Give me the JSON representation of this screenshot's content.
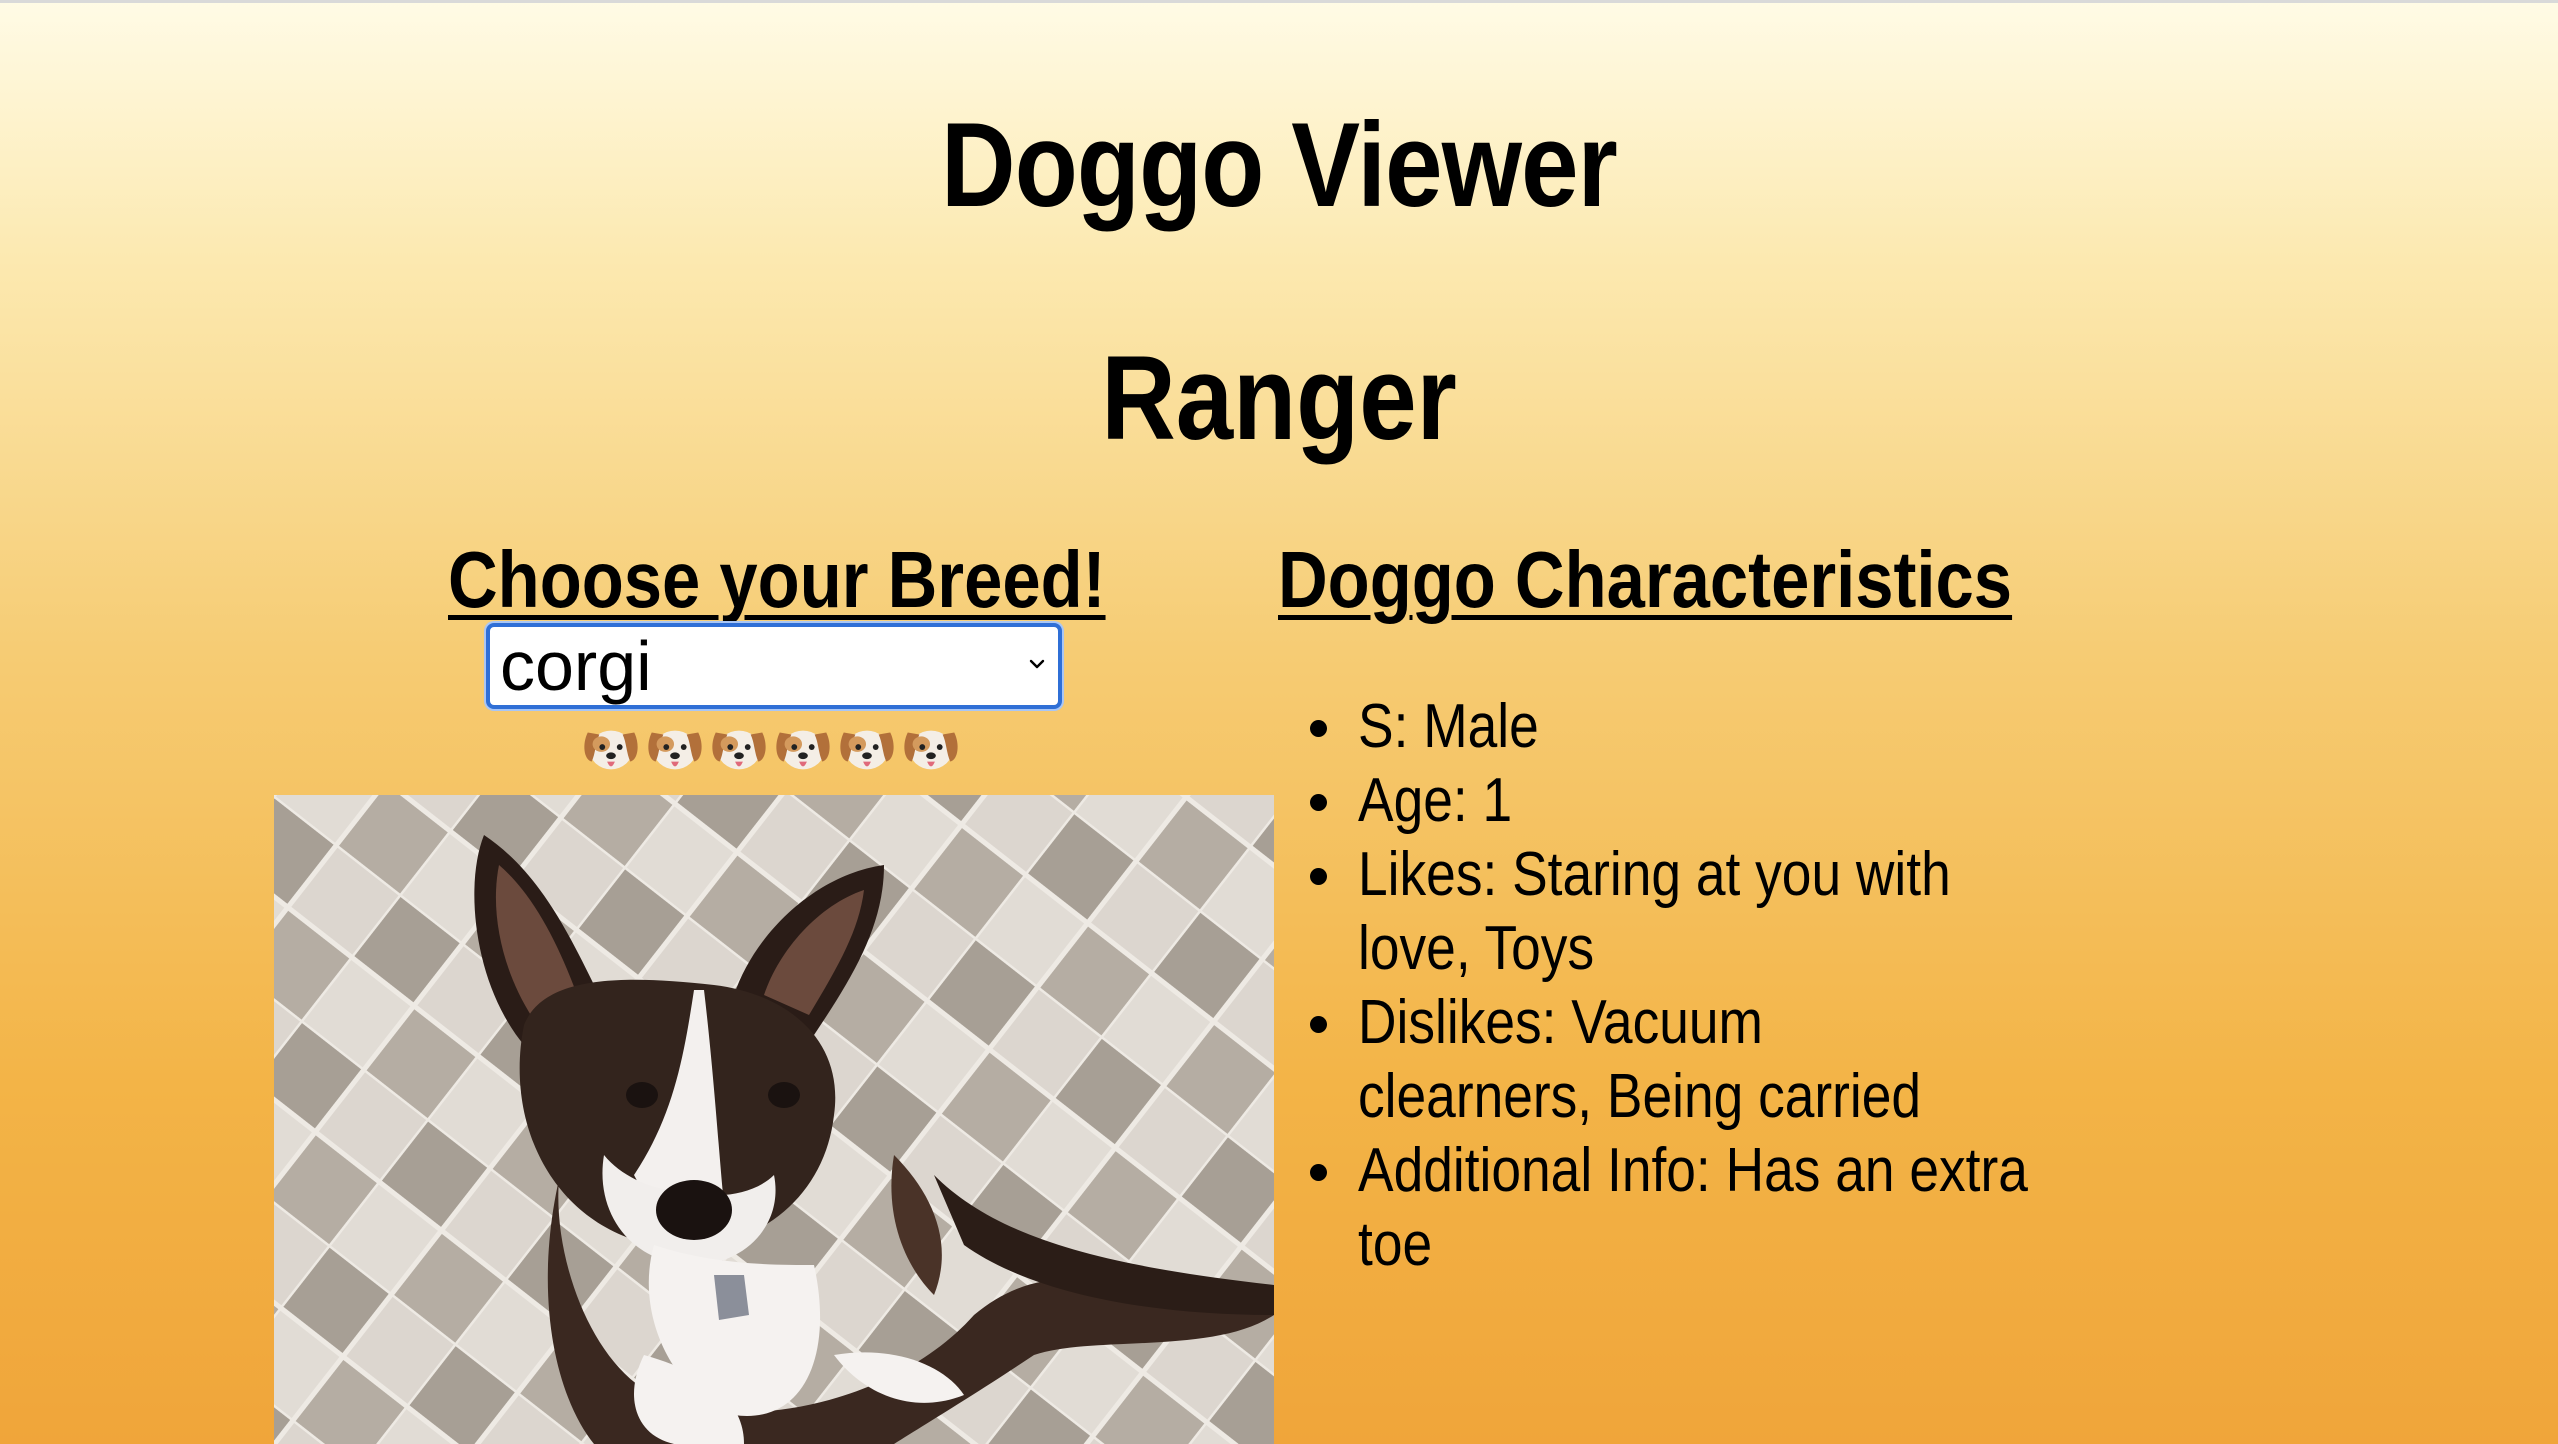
{
  "app": {
    "title": "Doggo Viewer",
    "dog_name": "Ranger"
  },
  "breed_picker": {
    "heading": "Choose your Breed!",
    "selected_value": "corgi",
    "emoji_count": 6,
    "emoji_icon": "dog-face-icon"
  },
  "photo": {
    "subject": "corgi-photo"
  },
  "characteristics": {
    "heading": "Doggo Characteristics",
    "items": [
      {
        "label": "S: Male"
      },
      {
        "label": "Age: 1"
      },
      {
        "label": "Likes: Staring at you with love, Toys"
      },
      {
        "label": "Dislikes: Vacuum clearners, Being carried"
      },
      {
        "label": "Additional Info: Has an extra toe"
      }
    ]
  },
  "colors": {
    "background_top": "#fffbe6",
    "background_bottom": "#f0a53a",
    "select_border": "#2f6fd6"
  }
}
